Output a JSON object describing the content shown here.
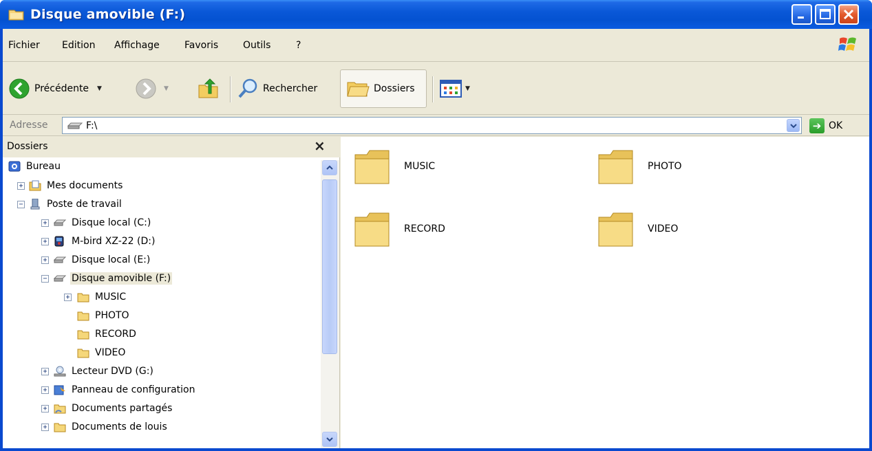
{
  "window": {
    "title": "Disque amovible (F:)"
  },
  "menu": [
    "Fichier",
    "Edition",
    "Affichage",
    "Favoris",
    "Outils",
    "?"
  ],
  "toolbar": {
    "back_label": "Précédente",
    "search_label": "Rechercher",
    "folders_label": "Dossiers"
  },
  "address": {
    "label": "Adresse",
    "value": "F:\\",
    "go_label": "OK"
  },
  "folder_pane": {
    "title": "Dossiers",
    "close": "×",
    "tree": [
      {
        "label": "Bureau"
      },
      {
        "label": "Mes documents"
      },
      {
        "label": "Poste de travail"
      },
      {
        "label": "Disque local (C:)"
      },
      {
        "label": "M-bird XZ-22 (D:)"
      },
      {
        "label": "Disque local (E:)"
      },
      {
        "label": "Disque amovible (F:)"
      },
      {
        "label": "MUSIC"
      },
      {
        "label": "PHOTO"
      },
      {
        "label": "RECORD"
      },
      {
        "label": "VIDEO"
      },
      {
        "label": "Lecteur DVD (G:)"
      },
      {
        "label": "Panneau de configuration"
      },
      {
        "label": "Documents partagés"
      },
      {
        "label": "Documents de louis"
      }
    ]
  },
  "content": {
    "items": [
      {
        "label": "MUSIC"
      },
      {
        "label": "PHOTO"
      },
      {
        "label": "RECORD"
      },
      {
        "label": "VIDEO"
      }
    ]
  },
  "colors": {
    "titlebar": "#0a58d8",
    "chrome": "#ece9d8",
    "folder": "#f5d77a"
  }
}
